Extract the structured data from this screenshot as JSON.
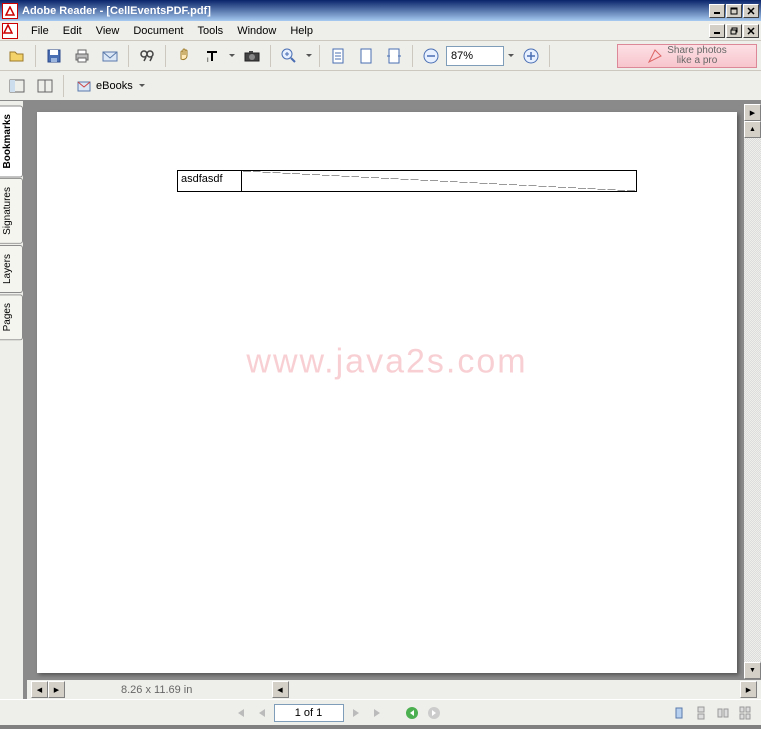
{
  "title": "Adobe Reader - [CellEventsPDF.pdf]",
  "menu": {
    "file": "File",
    "edit": "Edit",
    "view": "View",
    "document": "Document",
    "tools": "Tools",
    "window": "Window",
    "help": "Help"
  },
  "toolbar": {
    "zoom": "87%",
    "promo": "Share photos\nlike a pro"
  },
  "toolbar2": {
    "ebooks": "eBooks"
  },
  "sidebar": {
    "bookmarks": "Bookmarks",
    "signatures": "Signatures",
    "layers": "Layers",
    "pages": "Pages"
  },
  "document": {
    "cell_text": "asdfasdf",
    "watermark": "www.java2s.com",
    "dimensions": "8.26 x 11.69 in"
  },
  "status": {
    "page": "1 of 1"
  }
}
